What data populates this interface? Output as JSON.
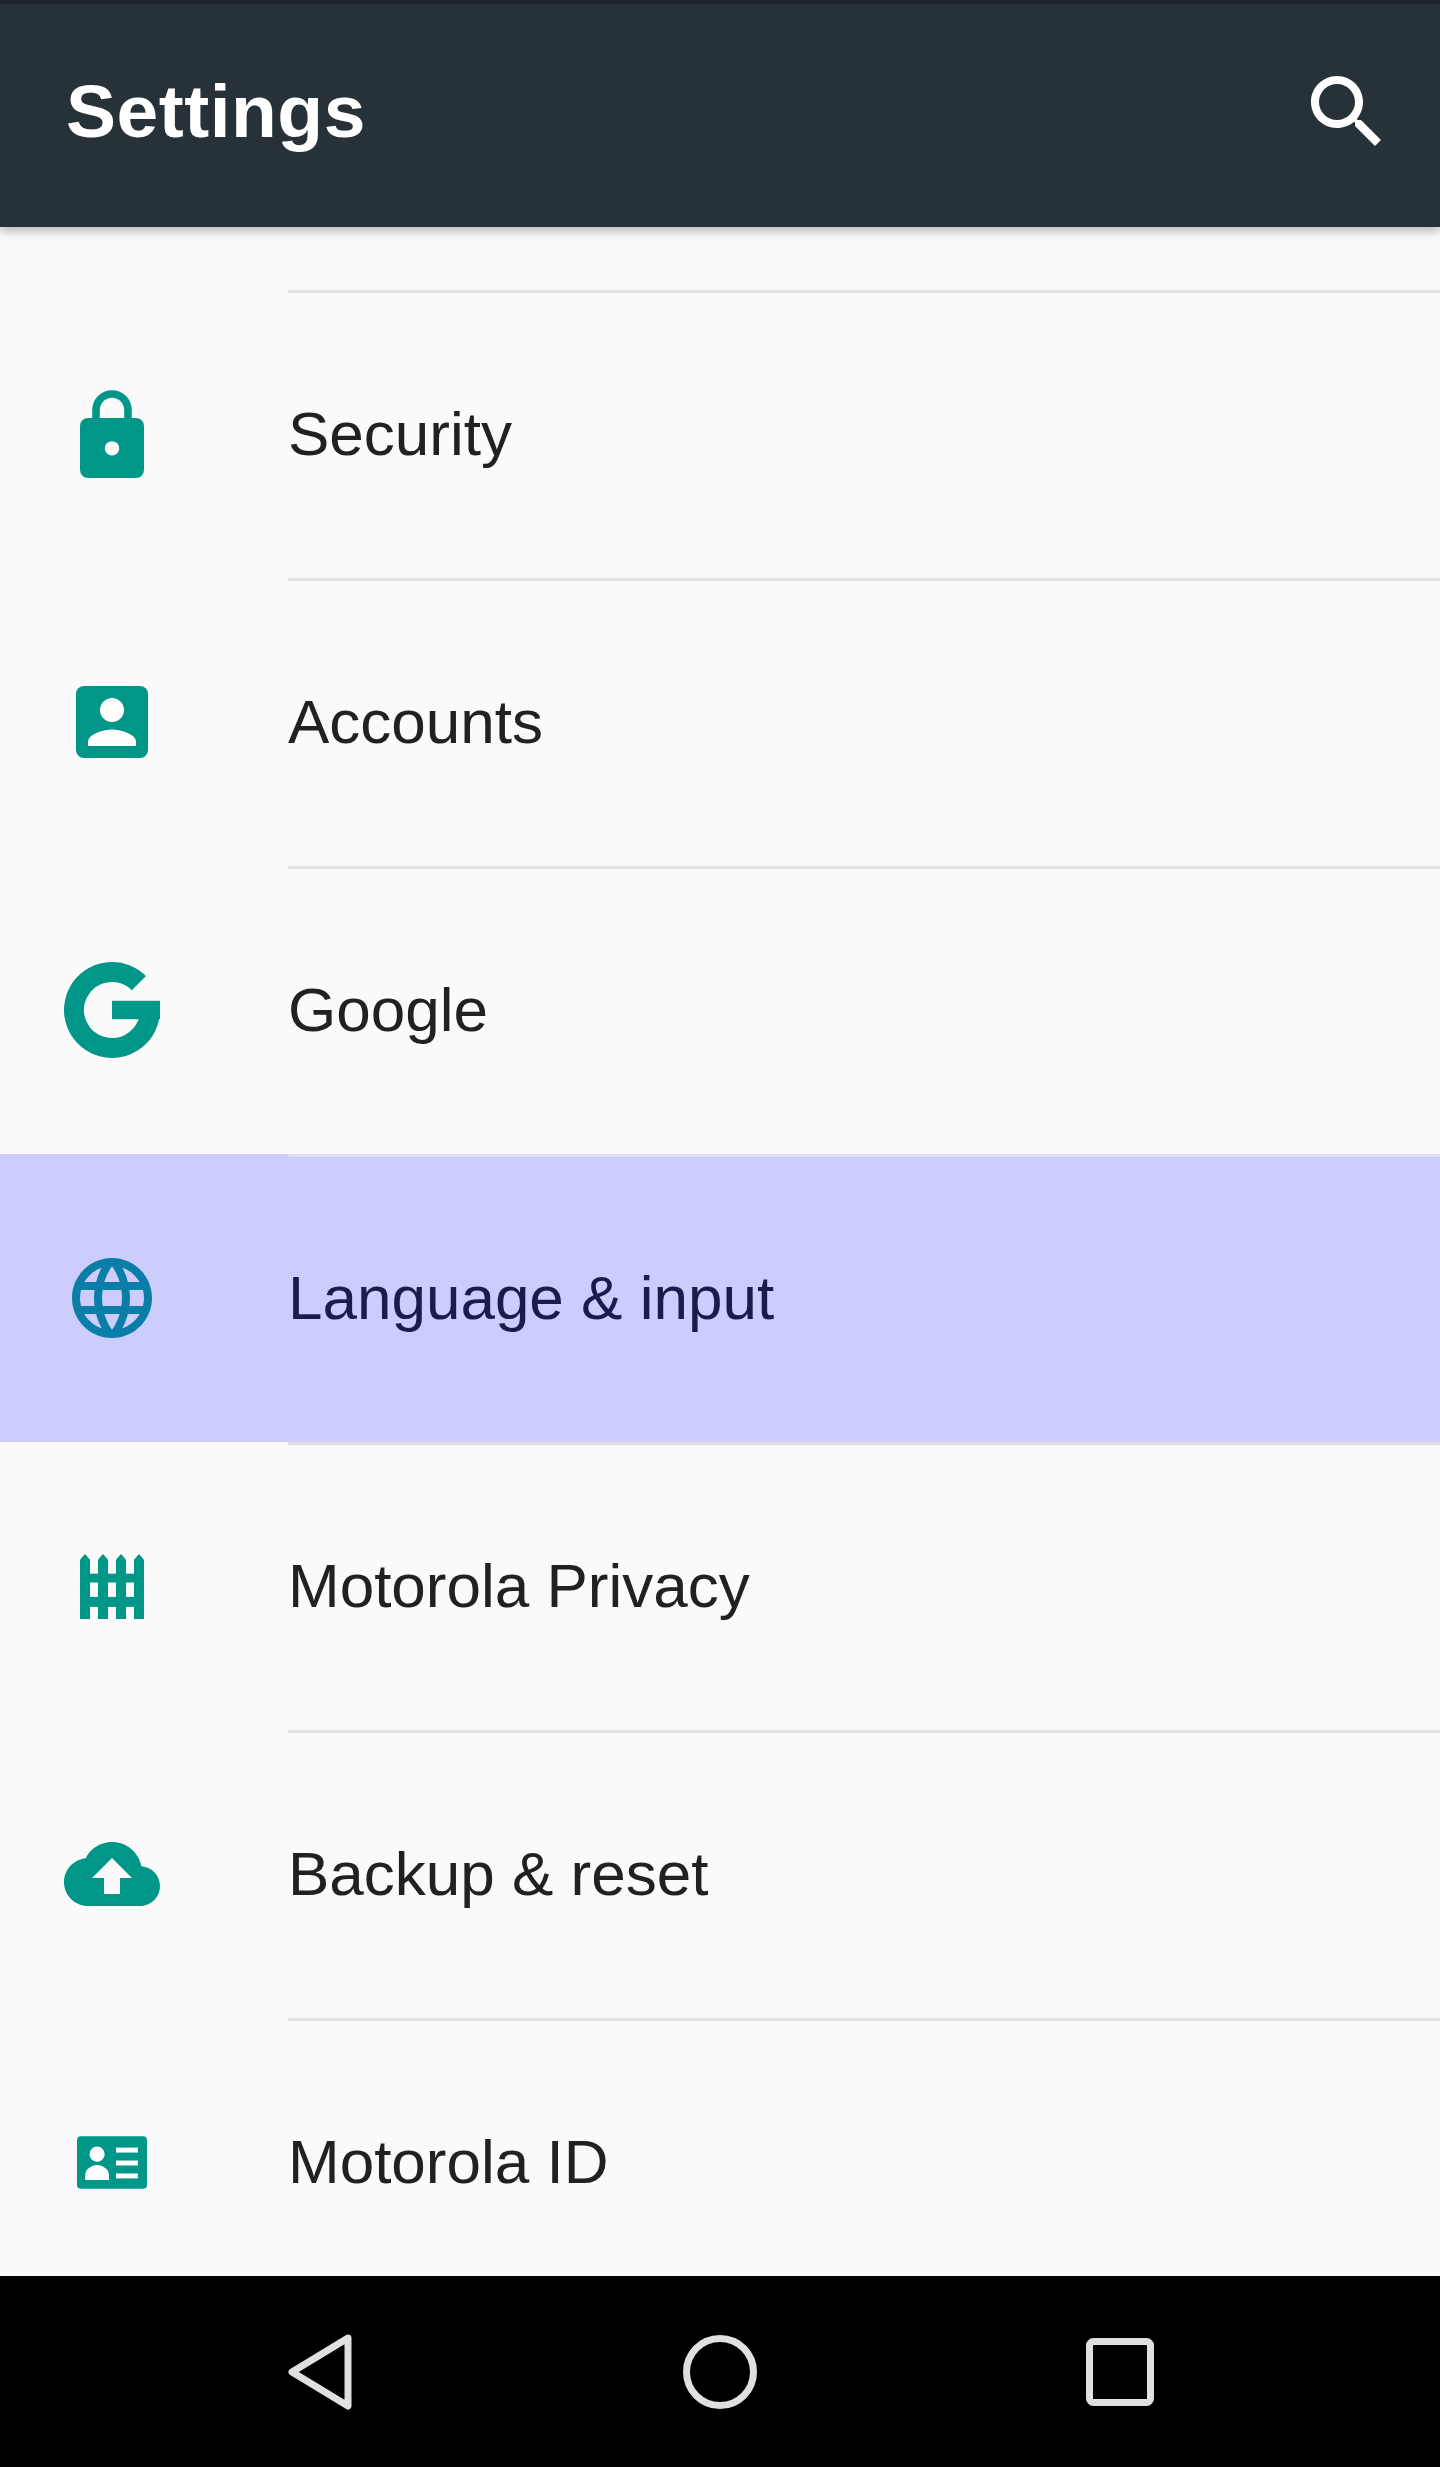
{
  "app_bar": {
    "title": "Settings"
  },
  "settings_items": [
    {
      "label": "Security",
      "selected": false
    },
    {
      "label": "Accounts",
      "selected": false
    },
    {
      "label": "Google",
      "selected": false
    },
    {
      "label": "Language & input",
      "selected": true
    },
    {
      "label": "Motorola Privacy",
      "selected": false
    },
    {
      "label": "Backup & reset",
      "selected": false
    },
    {
      "label": "Motorola ID",
      "selected": false
    }
  ]
}
